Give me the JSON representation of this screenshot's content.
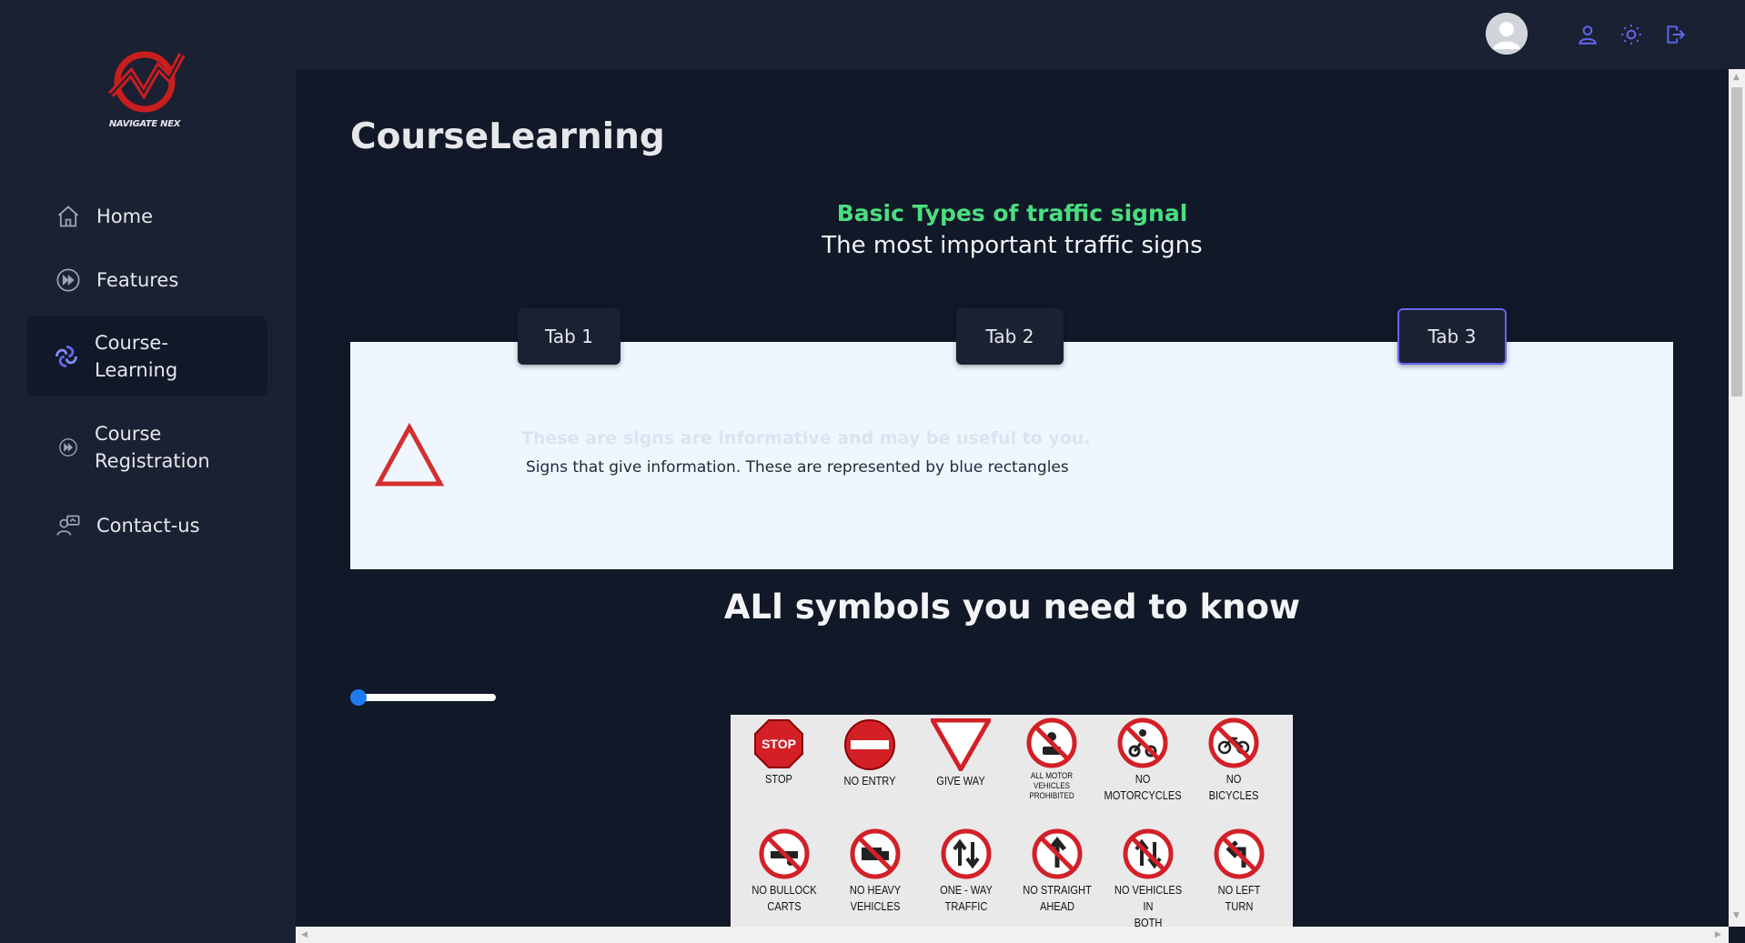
{
  "brand": {
    "name": "NAVIGATE NEX",
    "accent": "#dc2626"
  },
  "sidebar": {
    "items": [
      {
        "label": "Home",
        "icon": "home-icon"
      },
      {
        "label": "Features",
        "icon": "fast-forward-circle-icon"
      },
      {
        "label": "Course-\nLearning",
        "icon": "swirl-logo-icon",
        "active": true
      },
      {
        "label": "Course\nRegistration",
        "icon": "fast-forward-circle-icon"
      },
      {
        "label": "Contact-us",
        "icon": "contact-person-icon"
      }
    ]
  },
  "topbar": {
    "icons": [
      "avatar",
      "user-icon",
      "sun-icon",
      "logout-icon"
    ],
    "icon_color": "#6366f1"
  },
  "main": {
    "title": "CourseLearning",
    "subtitle_green": "Basic Types of traffic signal",
    "subtitle": "The most important traffic signs",
    "tabs": [
      {
        "label": "Tab 1"
      },
      {
        "label": "Tab 2"
      },
      {
        "label": "Tab 3",
        "selected": true
      }
    ],
    "panel": {
      "faded_text": "These are signs are informative and may be useful to you.",
      "text": "Signs that give information. These are represented by blue rectangles",
      "icon": "warning-triangle-icon"
    },
    "section_title": "ALl symbols you need to know",
    "slider": {
      "value": 0
    },
    "signs": [
      {
        "label": "STOP",
        "icon": "stop-sign"
      },
      {
        "label": "NO ENTRY",
        "icon": "no-entry-sign"
      },
      {
        "label": "GIVE WAY",
        "icon": "give-way-sign"
      },
      {
        "label": "ALL MOTOR\nVEHICLES PROHIBITED",
        "icon": "no-motor-vehicles-sign"
      },
      {
        "label": "NO\nMOTORCYCLES",
        "icon": "no-motorcycles-sign"
      },
      {
        "label": "NO\nBICYCLES",
        "icon": "no-bicycles-sign"
      },
      {
        "label": "NO BULLOCK\nCARTS",
        "icon": "no-bullock-carts-sign"
      },
      {
        "label": "NO HEAVY\nVEHICLES",
        "icon": "no-heavy-vehicles-sign"
      },
      {
        "label": "ONE - WAY\nTRAFFIC",
        "icon": "one-way-sign"
      },
      {
        "label": "NO STRAIGHT\nAHEAD",
        "icon": "no-straight-ahead-sign"
      },
      {
        "label": "NO VEHICLES IN\nBOTH DIRECTION",
        "icon": "no-vehicles-both-directions-sign"
      },
      {
        "label": "NO LEFT\nTURN",
        "icon": "no-left-turn-sign"
      }
    ]
  }
}
